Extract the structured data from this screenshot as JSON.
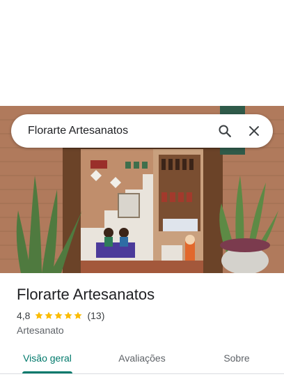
{
  "search": {
    "query": "Florarte Artesanatos"
  },
  "place": {
    "name": "Florarte Artesanatos",
    "rating": "4,8",
    "rating_fraction": 0.96,
    "stars_filled": 5,
    "review_count": "(13)",
    "category": "Artesanato"
  },
  "tabs": [
    {
      "label": "Visão geral",
      "active": true
    },
    {
      "label": "Avaliações",
      "active": false
    },
    {
      "label": "Sobre",
      "active": false
    }
  ],
  "icons": {
    "search": "search-icon",
    "close": "close-icon",
    "star": "star-icon"
  },
  "colors": {
    "accent": "#00796b",
    "star": "#fbbc04",
    "text": "#202124",
    "muted": "#5f6368"
  }
}
